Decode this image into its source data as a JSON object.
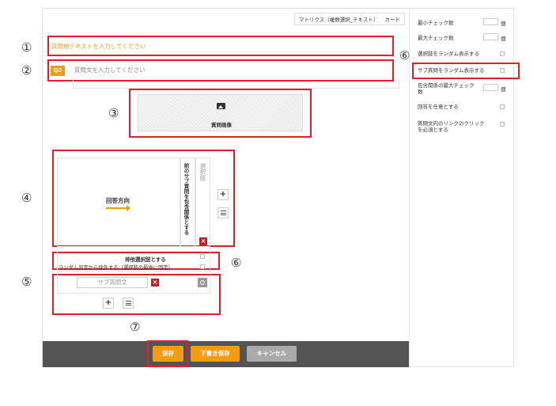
{
  "type_tags": [
    "マトリクス（複数選択_テキスト）",
    "カード"
  ],
  "settings": [
    {
      "label": "最小チェック数",
      "control": "number",
      "unit": "個"
    },
    {
      "label": "最大チェック数",
      "control": "number",
      "unit": "個"
    },
    {
      "label": "選択肢をランダム表示する",
      "control": "checkbox"
    },
    {
      "label": "サブ質問をランダム表示する",
      "control": "checkbox"
    },
    {
      "label": "包含関係の最大チェック数",
      "control": "number",
      "unit": "個"
    },
    {
      "label": "回答を任意とする",
      "control": "checkbox"
    },
    {
      "label": "質問文内のリンクのクリックを必須とする",
      "control": "checkbox"
    }
  ],
  "callouts": [
    "①",
    "②",
    "③",
    "④",
    "⑤",
    "⑥",
    "⑥",
    "⑦"
  ],
  "pre_text_placeholder": "質問前テキストを入力してください",
  "question_badge": "Q2",
  "question_placeholder": "質問文を入力してください",
  "image_label": "質問画像",
  "matrix": {
    "answer_direction": "回答方向",
    "column_header": "前のサブ質問を包含関係とする",
    "choice_placeholder": "選択肢",
    "exclusive_label": "排他選択肢とする",
    "random_exclude_label": "ランダム設定から除外する（選択肢の最後に固定）",
    "sub_question_placeholder": "サブ質問文"
  },
  "footer": {
    "save": "保存",
    "draft_save": "下書き保存",
    "cancel": "キャンセル"
  },
  "colors": {
    "accent": "#f39c12",
    "highlight": "#e0202a",
    "footer_bg": "#545454"
  }
}
